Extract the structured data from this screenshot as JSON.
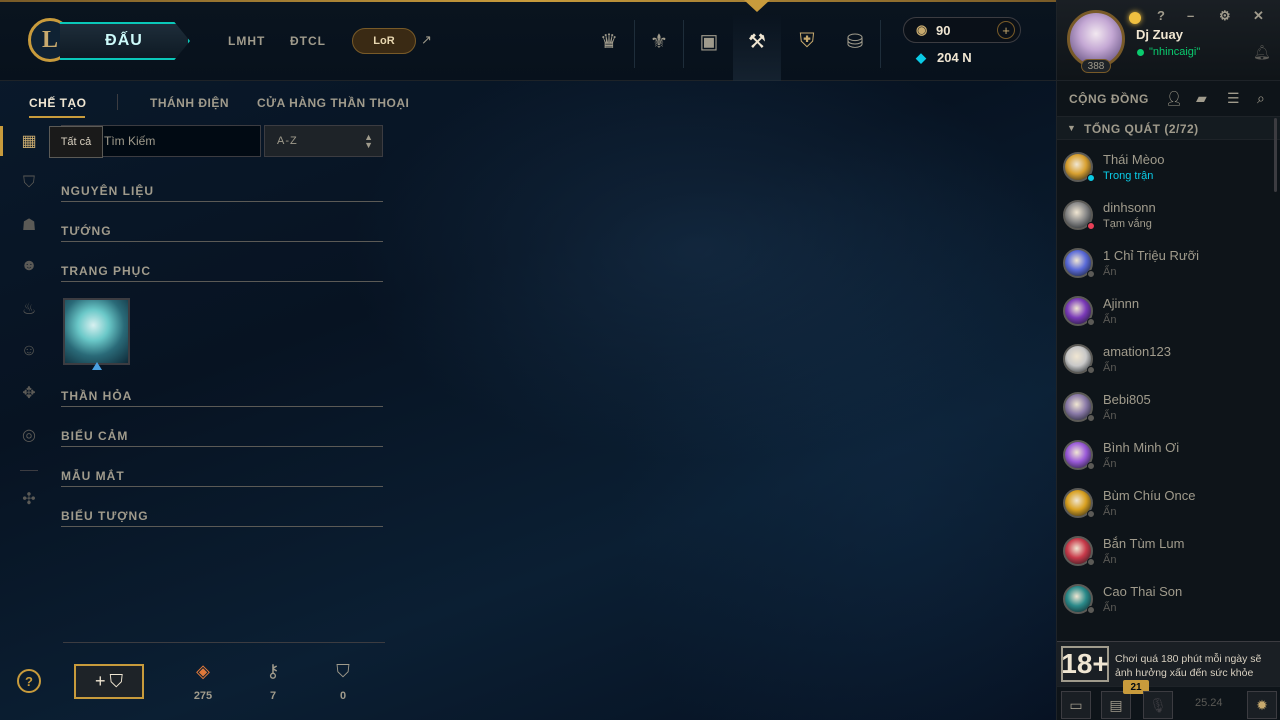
{
  "topnav": {
    "logo_letter": "L",
    "play_label": "ĐẤU",
    "links": [
      "LMHT",
      "ĐTCL"
    ],
    "lor_label": "LoR",
    "lor_arrow": "↗",
    "icons": [
      "worlds-icon",
      "ranked-icon",
      "collection-icon",
      "loot-icon",
      "clash-icon",
      "store-icon"
    ],
    "rp_value": "90",
    "be_value": "204 N",
    "plus": "+"
  },
  "profile": {
    "name": "Dj Zuay",
    "status": "\"nhincaigi\"",
    "level": "388",
    "help": "?",
    "minimize": "–",
    "settings": "⚙",
    "close": "✕"
  },
  "subnav": {
    "items": [
      "CHẾ TẠO",
      "THÁNH ĐIỆN",
      "CỬA HÀNG THẦN THOẠI"
    ]
  },
  "filter": {
    "tooltip": "Tất cả",
    "search_placeholder": "Tìm Kiếm",
    "sort_label": "A-Z"
  },
  "categories": [
    "NGUYÊN LIỆU",
    "TƯỚNG",
    "TRANG PHỤC",
    "THẦN HỎA",
    "BIỂU CẢM",
    "MẪU MẮT",
    "BIỂU TƯỢNG"
  ],
  "footer": {
    "help": "?",
    "craft_plus": "+",
    "orange_essence": "275",
    "keys": "7",
    "chests": "0"
  },
  "social": {
    "title": "CỘNG ĐỒNG",
    "group_label": "TỔNG QUÁT (2/72)",
    "friends": [
      {
        "name": "Thái Mèoo",
        "status": "Trong trận"
      },
      {
        "name": "dinhsonn",
        "status": "Tạm vắng"
      },
      {
        "name": "1 Chỉ Triệu Rưỡi",
        "status": "Ẩn"
      },
      {
        "name": "Ajinnn",
        "status": "Ẩn"
      },
      {
        "name": "amation123",
        "status": "Ẩn"
      },
      {
        "name": "Bebi805",
        "status": "Ẩn"
      },
      {
        "name": "Bình Minh Ơi",
        "status": "Ẩn"
      },
      {
        "name": "Bùm Chíu Once",
        "status": "Ẩn"
      },
      {
        "name": "Bắn Tùm Lum",
        "status": "Ẩn"
      },
      {
        "name": "Cao Thai Son",
        "status": "Ẩn"
      }
    ],
    "warning_age": "18+",
    "warning_text": "Chơi quá 180 phút mỗi ngày sẽ ảnh hưởng xấu đến sức khỏe",
    "badge_count": "21",
    "version": "25.24"
  },
  "colors": {
    "gold": "#c89b3c",
    "teal": "#0ac8b9",
    "online_green": "#0acb6e",
    "ingame_blue": "#0acbe6",
    "away_red": "#e84057"
  }
}
